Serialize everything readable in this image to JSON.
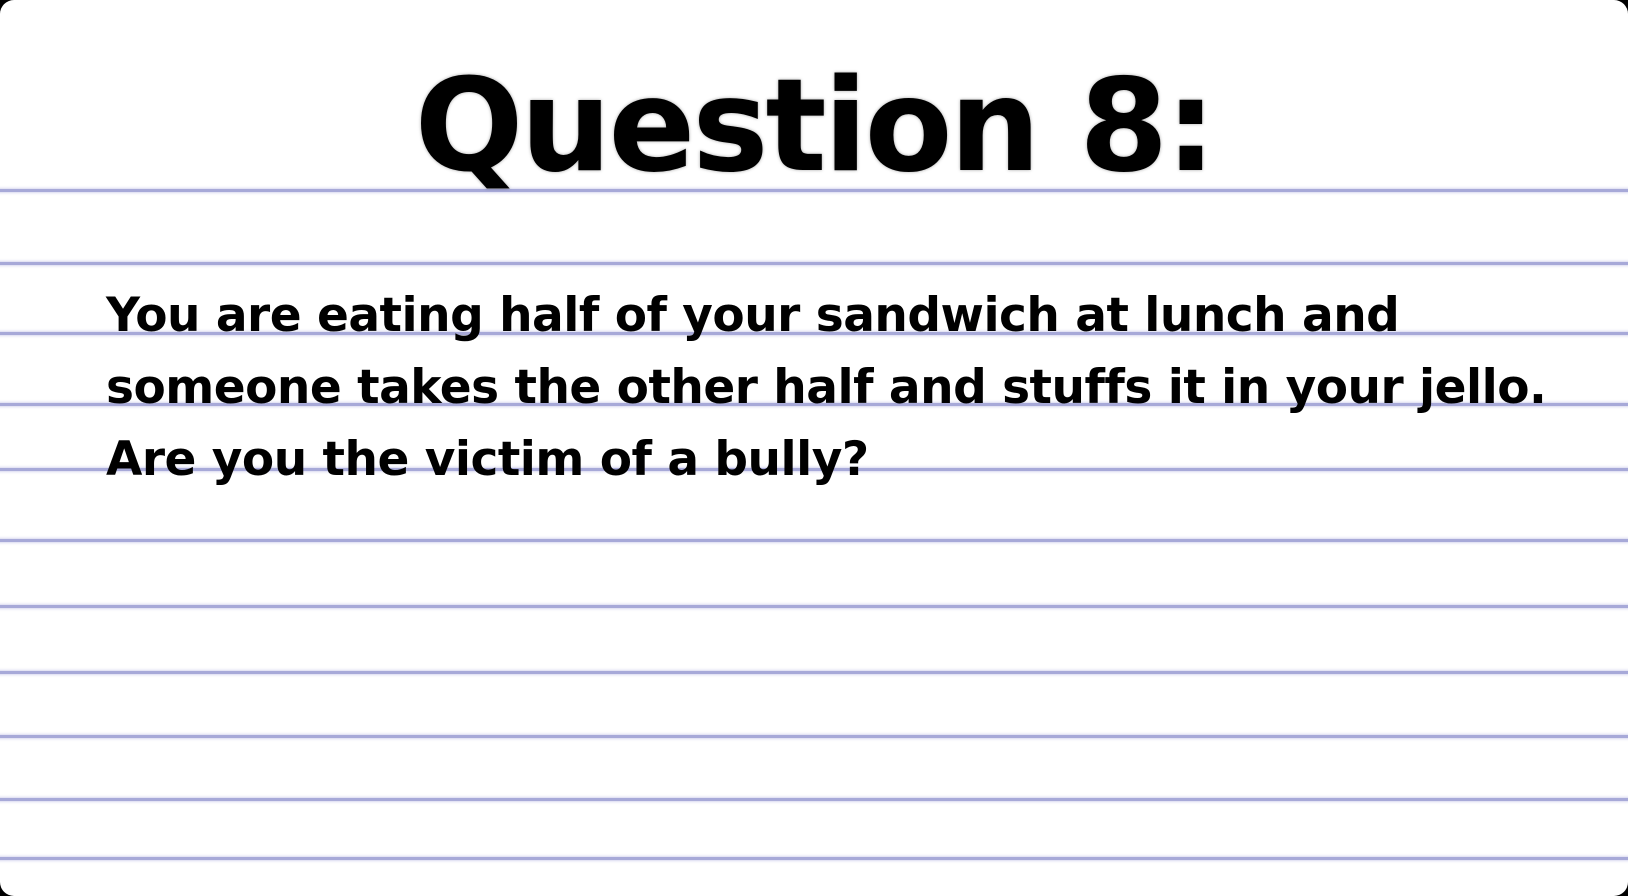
{
  "slide": {
    "title": "Question 8:",
    "question": "You are eating half of your sandwich at lunch and someone takes the other half and stuffs it in your jello. Are you the victim of a bully?"
  },
  "colors": {
    "background": "#ffffff",
    "text": "#000000",
    "ruled_lines": "#a7a9d8",
    "frame": "#000000"
  }
}
